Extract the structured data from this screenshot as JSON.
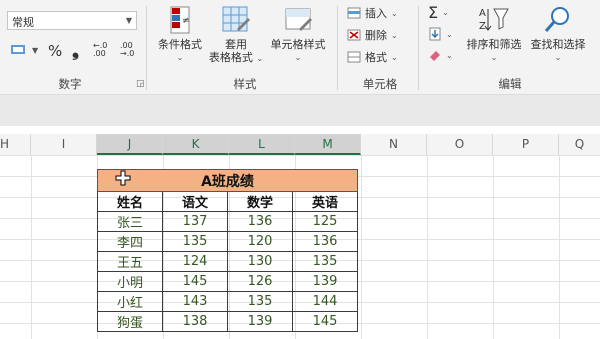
{
  "ribbon": {
    "number_format_value": "常规",
    "number_symbols": [
      "%",
      "❟",
      "←.0 .00",
      ".00 →.0"
    ],
    "groups": {
      "number": "数字",
      "styles": "样式",
      "cells": "单元格",
      "editing": "编辑"
    },
    "buttons": {
      "conditional_format": "条件格式",
      "format_as_table_1": "套用",
      "format_as_table_2": "表格格式",
      "cell_styles": "单元格样式",
      "insert": "插入",
      "delete": "删除",
      "format": "格式",
      "sort_filter": "排序和筛选",
      "find_select": "查找和选择"
    }
  },
  "columns": [
    "H",
    "I",
    "J",
    "K",
    "L",
    "M",
    "N",
    "O",
    "P",
    "Q"
  ],
  "table": {
    "title": "A班成绩",
    "headers": [
      "姓名",
      "语文",
      "数学",
      "英语"
    ],
    "rows": [
      [
        "张三",
        "137",
        "136",
        "125"
      ],
      [
        "李四",
        "135",
        "120",
        "136"
      ],
      [
        "王五",
        "124",
        "130",
        "135"
      ],
      [
        "小明",
        "145",
        "126",
        "139"
      ],
      [
        "小红",
        "143",
        "135",
        "144"
      ],
      [
        "狗蛋",
        "138",
        "139",
        "145"
      ]
    ]
  },
  "colors": {
    "title_fill": "#f4b183",
    "selection": "#217346",
    "data_text": "#375623"
  }
}
